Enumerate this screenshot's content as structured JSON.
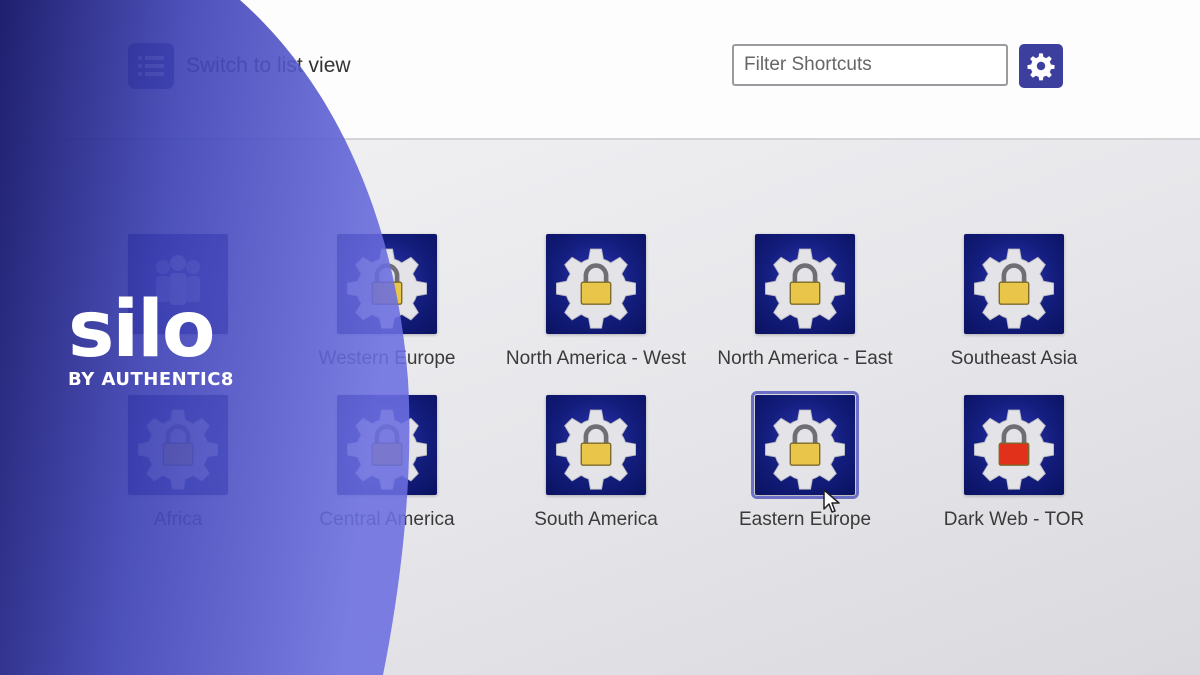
{
  "header": {
    "list_toggle_label": "Switch to list view",
    "filter_placeholder": "Filter Shortcuts"
  },
  "shortcuts": [
    {
      "label": "Western Europe",
      "icon": "gear-lock-icon",
      "lock_color": "#e9c64a"
    },
    {
      "label": "North America - West",
      "icon": "gear-lock-icon",
      "lock_color": "#e9c64a"
    },
    {
      "label": "North America - East",
      "icon": "gear-lock-icon",
      "lock_color": "#e9c64a"
    },
    {
      "label": "Southeast Asia",
      "icon": "gear-lock-icon",
      "lock_color": "#e9c64a"
    },
    {
      "label": "Africa",
      "icon": "gear-lock-icon",
      "lock_color": "#e9c64a"
    },
    {
      "label": "Central America",
      "icon": "gear-lock-icon",
      "lock_color": "#e9c64a"
    },
    {
      "label": "South America",
      "icon": "gear-lock-icon",
      "lock_color": "#e9c64a"
    },
    {
      "label": "Eastern Europe",
      "icon": "gear-lock-icon",
      "lock_color": "#e9c64a",
      "selected": true
    },
    {
      "label": "Dark Web - TOR",
      "icon": "gear-lock-icon",
      "lock_color": "#e2311b"
    }
  ],
  "brand": {
    "name": "silo",
    "tagline": "BY AUTHENTIC8"
  },
  "colors": {
    "accent": "#3c3f9e",
    "tile_bg": "#131d7c",
    "overlay_dark": "#1a1b6b",
    "overlay_light": "#6b6ee0"
  }
}
